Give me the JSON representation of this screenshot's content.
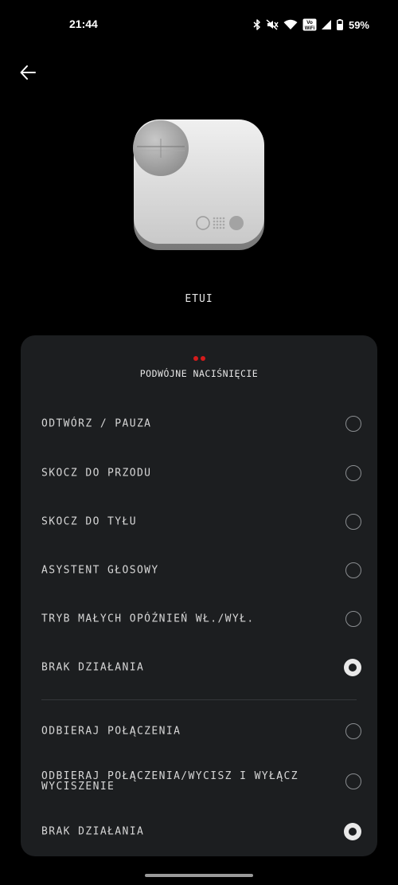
{
  "status_bar": {
    "time": "21:44",
    "icons": [
      "bluetooth-icon",
      "mute-icon",
      "wifi-icon",
      "vowifi-icon",
      "signal-icon",
      "battery-icon"
    ],
    "vowifi_top": "Vo",
    "vowifi_bottom": "WiFi",
    "battery": "59%"
  },
  "header": {
    "back_icon": "arrow-left-icon"
  },
  "device": {
    "label": "ETUI"
  },
  "panel": {
    "title": "PODWÓJNE NACIŚNIĘCIE",
    "accent_color": "#d51b1b",
    "group1": [
      {
        "label": "ODTWÓRZ / PAUZA",
        "selected": false
      },
      {
        "label": "SKOCZ DO PRZODU",
        "selected": false
      },
      {
        "label": "SKOCZ DO TYŁU",
        "selected": false
      },
      {
        "label": "ASYSTENT GŁOSOWY",
        "selected": false
      },
      {
        "label": "TRYB MAŁYCH OPÓŹNIEŃ WŁ./WYŁ.",
        "selected": false
      },
      {
        "label": "BRAK DZIAŁANIA",
        "selected": true
      }
    ],
    "group2": [
      {
        "label": "ODBIERAJ POŁĄCZENIA",
        "selected": false
      },
      {
        "label": "ODBIERAJ POŁĄCZENIA/WYCISZ I WYŁĄCZ WYCISZENIE",
        "selected": false
      },
      {
        "label": "BRAK DZIAŁANIA",
        "selected": true
      }
    ]
  }
}
